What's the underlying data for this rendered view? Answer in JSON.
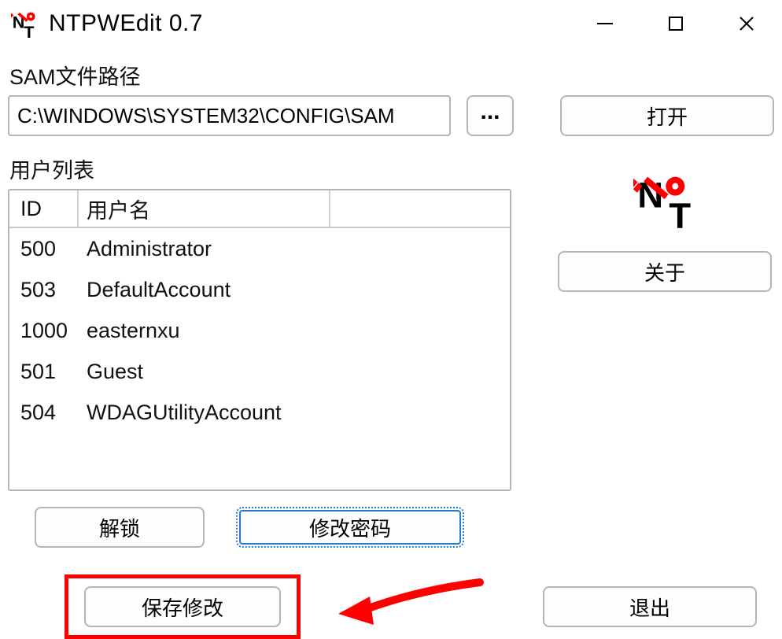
{
  "window": {
    "title": "NTPWEdit 0.7"
  },
  "sam": {
    "label": "SAM文件路径",
    "path": "C:\\WINDOWS\\SYSTEM32\\CONFIG\\SAM",
    "browse": "...",
    "open": "打开"
  },
  "users": {
    "label": "用户列表",
    "columns": {
      "id": "ID",
      "name": "用户名"
    },
    "rows": [
      {
        "id": "500",
        "name": "Administrator"
      },
      {
        "id": "503",
        "name": "DefaultAccount"
      },
      {
        "id": "1000",
        "name": "easternxu"
      },
      {
        "id": "501",
        "name": "Guest"
      },
      {
        "id": "504",
        "name": "WDAGUtilityAccount"
      }
    ],
    "unlock": "解锁",
    "change_pw": "修改密码"
  },
  "about": "关于",
  "save": "保存修改",
  "exit": "退出"
}
